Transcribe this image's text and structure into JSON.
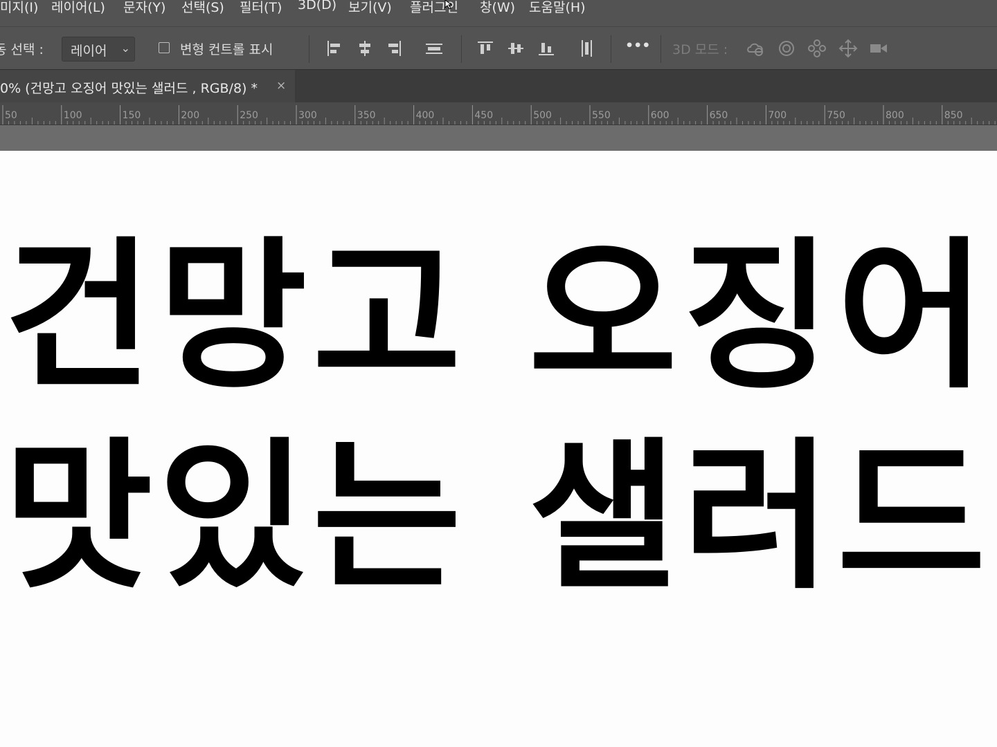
{
  "menu": {
    "items": [
      "미지(I)",
      "레이어(L)",
      "문자(Y)",
      "선택(S)",
      "필터(T)",
      "3D(D)",
      "보기(V)",
      "플러그인",
      "창(W)",
      "도움말(H)"
    ]
  },
  "options": {
    "select_label": "동 선택 :",
    "select_value": "레이어",
    "transform_label": "변형 컨트롤 표시",
    "more_label": "•••",
    "mode_label": "3D 모드 :"
  },
  "icons": {
    "align": [
      "align-left-edges-icon",
      "align-horizontal-centers-icon",
      "align-right-edges-icon",
      "distribute-horizontal-icon",
      "align-top-edges-icon",
      "align-vertical-centers-icon",
      "align-bottom-edges-icon",
      "distribute-vertical-icon"
    ],
    "mode3d": [
      "orbit-3d-icon",
      "roll-3d-icon",
      "drag-3d-icon",
      "slide-3d-icon",
      "scale-3d-icon"
    ]
  },
  "document": {
    "tab_title": "0% (건망고 오징어 맛있는 샐러드 , RGB/8) *",
    "close_symbol": "×"
  },
  "ruler": {
    "labels": [
      "50",
      "100",
      "150",
      "200",
      "250",
      "300",
      "350",
      "400",
      "450",
      "500",
      "550",
      "600",
      "650",
      "700",
      "750",
      "800",
      "850"
    ]
  },
  "canvas": {
    "line1": "건망고 오징어",
    "line2": "맛있는 샐러드"
  }
}
